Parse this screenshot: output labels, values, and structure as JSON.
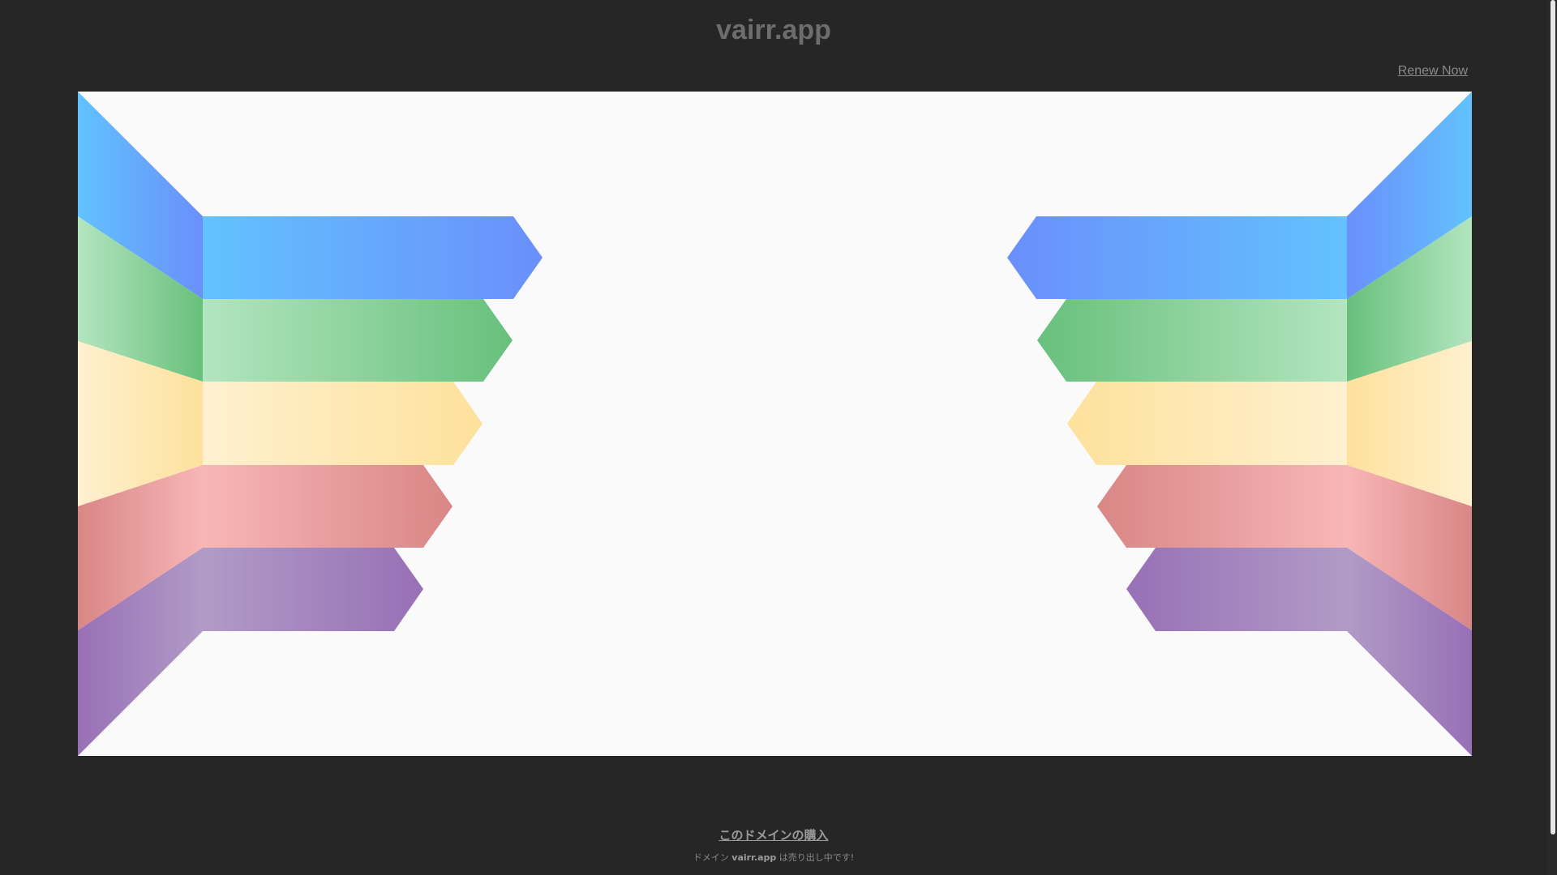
{
  "header": {
    "site_title": "vairr.app",
    "renew_label": "Renew Now"
  },
  "footer": {
    "buy_label": "このドメインの購入",
    "sale_prefix": "ドメイン",
    "sale_domain": "vairr.app",
    "sale_suffix": "は売り出し中です!"
  },
  "banner": {
    "stripe_colors": [
      [
        "#62c2fe",
        "#6a8ffb"
      ],
      [
        "#b3e5bf",
        "#68c07c"
      ],
      [
        "#fff0cf",
        "#fde19c"
      ],
      [
        "#f8b6b6",
        "#d98686"
      ],
      [
        "#b19bc6",
        "#9870b6"
      ]
    ]
  }
}
